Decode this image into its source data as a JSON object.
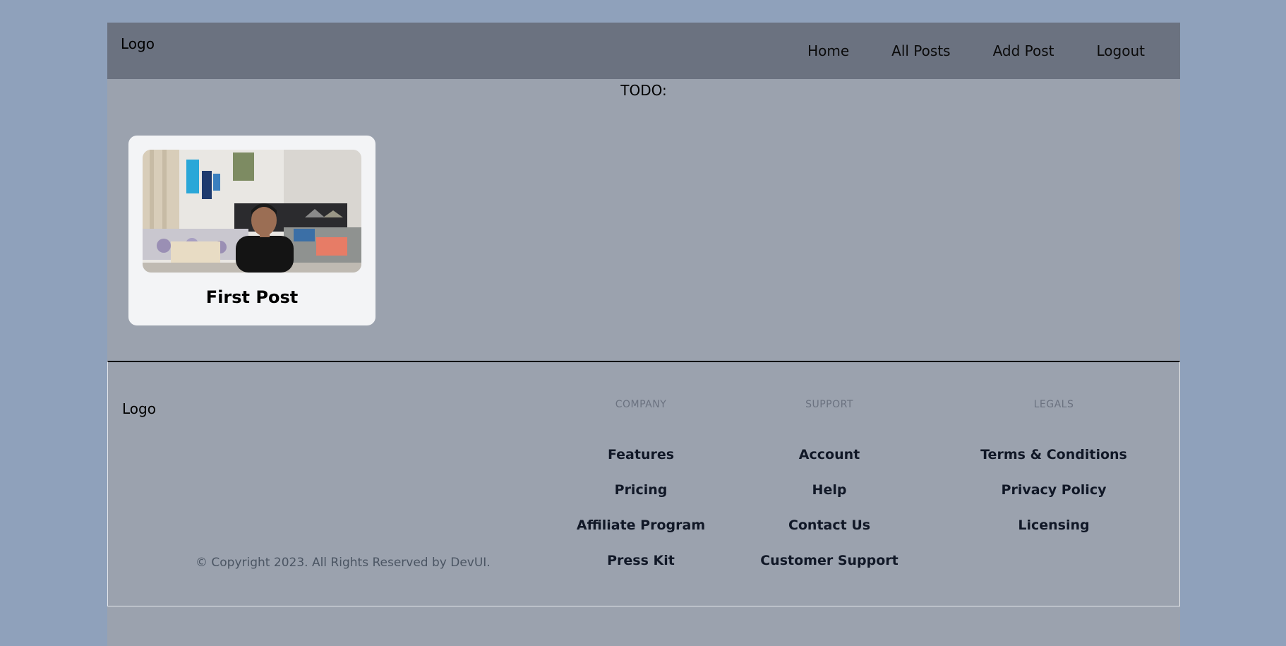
{
  "header": {
    "logo": "Logo",
    "nav": [
      "Home",
      "All Posts",
      "Add Post",
      "Logout"
    ]
  },
  "main": {
    "todo": "TODO:",
    "posts": [
      {
        "title": "First Post",
        "image": "photo-of-person-in-room"
      }
    ]
  },
  "footer": {
    "logo": "Logo",
    "copyright": "© Copyright 2023. All Rights Reserved by DevUI.",
    "columns": [
      {
        "heading": "COMPANY",
        "links": [
          "Features",
          "Pricing",
          "Affiliate Program",
          "Press Kit"
        ]
      },
      {
        "heading": "SUPPORT",
        "links": [
          "Account",
          "Help",
          "Contact Us",
          "Customer Support"
        ]
      },
      {
        "heading": "LEGALS",
        "links": [
          "Terms & Conditions",
          "Privacy Policy",
          "Licensing"
        ]
      }
    ]
  },
  "colors": {
    "background": "#8fa1bb",
    "page": "#9ba2ae",
    "header": "#6b7280",
    "card": "#f3f4f6"
  }
}
